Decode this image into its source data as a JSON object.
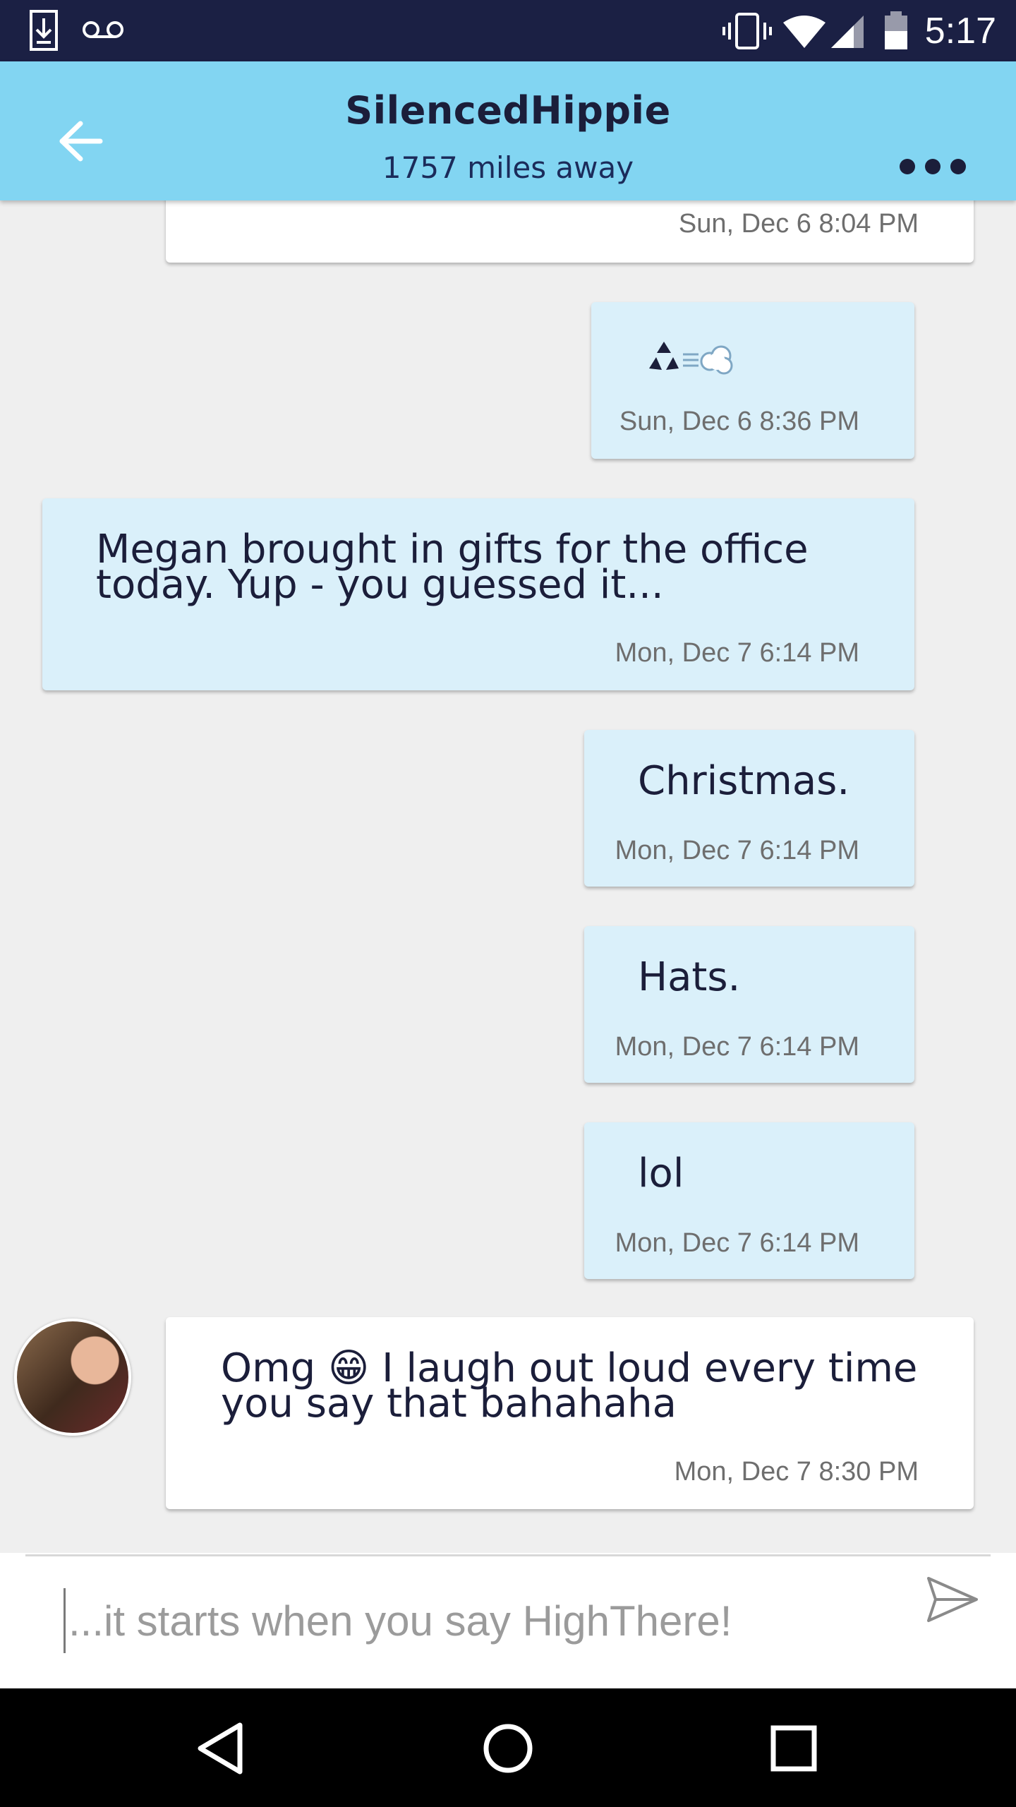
{
  "status_bar": {
    "time": "5:17",
    "left_icons": [
      "download-icon",
      "voicemail-icon"
    ],
    "right_icons": [
      "vibrate-icon",
      "wifi-icon",
      "signal-icon",
      "battery-icon"
    ]
  },
  "header": {
    "title": "SilencedHippie",
    "subtitle": "1757 miles away",
    "back_icon": "arrow-left-icon",
    "menu_icon": "more-dots-icon",
    "background": "#82d5f2"
  },
  "messages": [
    {
      "direction": "in",
      "text": "",
      "time": "Sun, Dec 6 8:04 PM"
    },
    {
      "direction": "out",
      "text": "♻💨",
      "time": "Sun, Dec 6 8:36 PM"
    },
    {
      "direction": "out",
      "text": "Megan brought in gifts for the office\ntoday.  Yup - you guessed it...",
      "time": "Mon, Dec 7 6:14 PM"
    },
    {
      "direction": "out",
      "text": "Christmas.",
      "time": "Mon, Dec 7 6:14 PM"
    },
    {
      "direction": "out",
      "text": "Hats.",
      "time": "Mon, Dec 7 6:14 PM"
    },
    {
      "direction": "out",
      "text": "lol",
      "time": "Mon, Dec 7 6:14 PM"
    },
    {
      "direction": "in",
      "text": "Omg 😁 I laugh out loud every time\nyou say that bahahaha",
      "time": "Mon, Dec 7 8:30 PM",
      "avatar": true
    }
  ],
  "composer": {
    "placeholder": "...it starts when you say HighThere!",
    "send_icon": "send-icon"
  },
  "nav_bar": {
    "icons": [
      "back-triangle-icon",
      "home-circle-icon",
      "recents-square-icon"
    ]
  },
  "colors": {
    "outgoing_bubble": "#daf0fa",
    "incoming_bubble": "#ffffff",
    "text": "#1b1e3a",
    "timestamp": "#6e6e6e"
  }
}
